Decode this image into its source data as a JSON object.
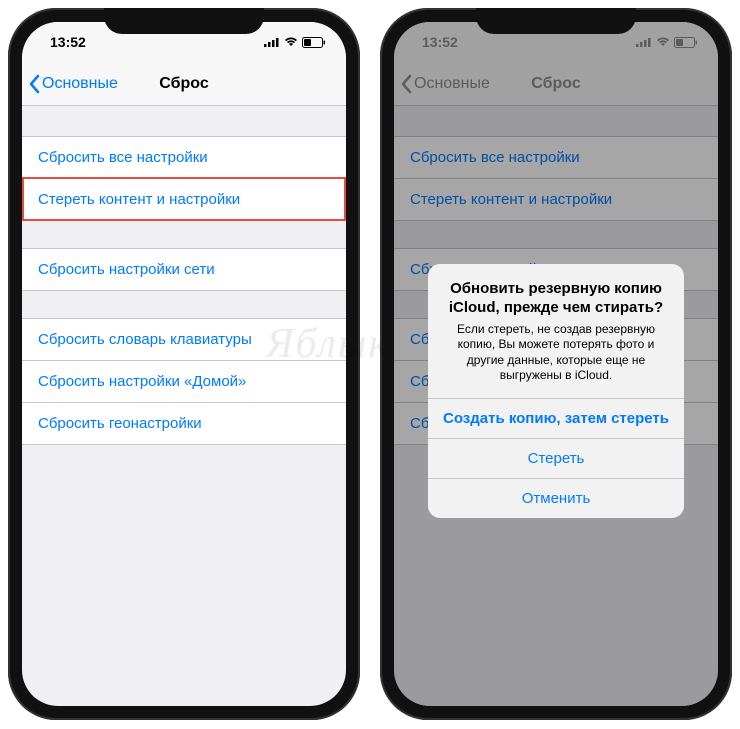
{
  "status": {
    "time": "13:52"
  },
  "nav": {
    "back": "Основные",
    "title": "Сброс"
  },
  "groups": [
    [
      "Сбросить все настройки",
      "Стереть контент и настройки"
    ],
    [
      "Сбросить настройки сети"
    ],
    [
      "Сбросить словарь клавиатуры",
      "Сбросить настройки «Домой»",
      "Сбросить геонастройки"
    ]
  ],
  "alert": {
    "title": "Обновить резервную копию iCloud, прежде чем стирать?",
    "message": "Если стереть, не создав резервную копию, Вы можете потерять фото и другие данные, которые еще не выгружены в iCloud.",
    "primary": "Создать копию, затем стереть",
    "secondary": "Стереть",
    "cancel": "Отменить"
  },
  "watermark": "Яблык"
}
